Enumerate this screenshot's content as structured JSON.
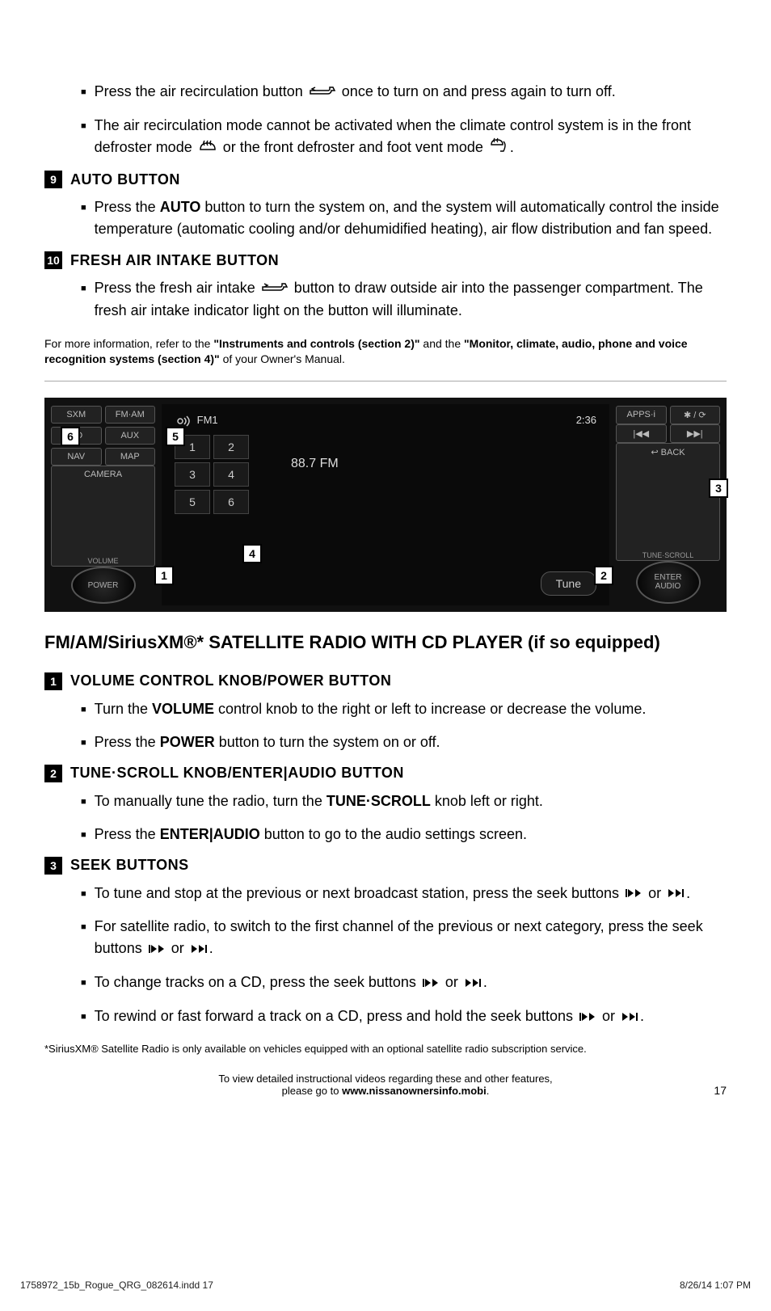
{
  "top_bullets": [
    {
      "parts": [
        "Press the air recirculation button ",
        {
          "icon": "recirc"
        },
        " once to turn on and press again to turn off."
      ]
    },
    {
      "parts": [
        "The air recirculation mode cannot be activated when the climate control system is in the front defroster mode ",
        {
          "icon": "defrost"
        },
        " or the front defroster and foot vent mode ",
        {
          "icon": "defrost-foot"
        },
        "."
      ]
    }
  ],
  "section9": {
    "num": "9",
    "title": "AUTO BUTTON",
    "bullets": [
      {
        "parts": [
          "Press the ",
          {
            "bold": "AUTO"
          },
          " button to turn the system on, and the system will automatically control the inside temperature (automatic cooling and/or dehumidified heating), air flow distribution and fan speed."
        ]
      }
    ]
  },
  "section10": {
    "num": "10",
    "title": "FRESH AIR INTAKE BUTTON",
    "bullets": [
      {
        "parts": [
          "Press the fresh air intake ",
          {
            "icon": "fresh-air"
          },
          " button to draw outside air into the passenger compartment. The fresh air intake indicator light on the button will illuminate."
        ]
      }
    ]
  },
  "info_note": {
    "prefix": "For more information, refer to the ",
    "ref1": "\"Instruments and controls (section 2)\"",
    "mid": " and the ",
    "ref2": "\"Monitor, climate, audio, phone and voice recognition systems (section 4)\"",
    "suffix": " of your Owner's Manual."
  },
  "radio": {
    "left_buttons": [
      "SXM",
      "FM·AM",
      "CD",
      "AUX",
      "NAV",
      "MAP"
    ],
    "camera": "CAMERA",
    "volume_label": "VOLUME",
    "power": "POWER",
    "fm_label": "FM1",
    "time": "2:36",
    "frequency": "88.7 FM",
    "presets": [
      "1",
      "2",
      "3",
      "4",
      "5",
      "6"
    ],
    "tune": "Tune",
    "right_buttons": [
      "APPS·i",
      "✱ / ⟳"
    ],
    "seek_buttons": [
      "|◀◀",
      "▶▶|"
    ],
    "back": "↩ BACK",
    "tune_scroll_label": "TUNE·SCROLL",
    "enter_audio": "ENTER\nAUDIO",
    "callouts": {
      "c1": "1",
      "c2": "2",
      "c3": "3",
      "c4": "4",
      "c5": "5",
      "c6": "6"
    }
  },
  "radio_title": "FM/AM/SiriusXM®* SATELLITE RADIO WITH CD PLAYER (if so equipped)",
  "rsection1": {
    "num": "1",
    "title": "VOLUME CONTROL KNOB/POWER BUTTON",
    "bullets": [
      {
        "parts": [
          "Turn the ",
          {
            "bold": "VOLUME"
          },
          " control knob to the right or left to increase or decrease the volume."
        ]
      },
      {
        "parts": [
          "Press the ",
          {
            "bold": "POWER"
          },
          " button to turn the system on or off."
        ]
      }
    ]
  },
  "rsection2": {
    "num": "2",
    "title": "TUNE·SCROLL KNOB/ENTER|AUDIO BUTTON",
    "bullets": [
      {
        "parts": [
          "To manually tune the radio, turn the ",
          {
            "bold": "TUNE·SCROLL"
          },
          " knob left or right."
        ]
      },
      {
        "parts": [
          "Press the ",
          {
            "bold": "ENTER|AUDIO"
          },
          " button to go to the audio settings screen."
        ]
      }
    ]
  },
  "rsection3": {
    "num": "3",
    "title": "SEEK BUTTONS",
    "bullets": [
      {
        "parts": [
          "To tune and stop at the previous or next broadcast station, press the seek buttons ",
          {
            "icon": "seek-prev"
          },
          " or ",
          {
            "icon": "seek-next"
          },
          "."
        ]
      },
      {
        "parts": [
          "For satellite radio, to switch to the first channel of the previous or next category, press the seek buttons ",
          {
            "icon": "seek-prev"
          },
          " or ",
          {
            "icon": "seek-next"
          },
          "."
        ]
      },
      {
        "parts": [
          "To change tracks on a CD, press the seek buttons ",
          {
            "icon": "seek-prev"
          },
          " or ",
          {
            "icon": "seek-next"
          },
          "."
        ]
      },
      {
        "parts": [
          "To rewind or fast forward a track on a CD, press and hold the seek buttons ",
          {
            "icon": "seek-prev"
          },
          " or ",
          {
            "icon": "seek-next"
          },
          "."
        ]
      }
    ]
  },
  "footnote": "*SiriusXM® Satellite Radio is only available on vehicles equipped with an optional satellite radio subscription service.",
  "info_footer": {
    "line1": "To view detailed instructional videos regarding these and other features,",
    "line2_prefix": "please go to ",
    "line2_bold": "www.nissanownersinfo.mobi",
    "line2_suffix": "."
  },
  "page_num": "17",
  "print_left": "1758972_15b_Rogue_QRG_082614.indd   17",
  "print_right": "8/26/14   1:07 PM"
}
